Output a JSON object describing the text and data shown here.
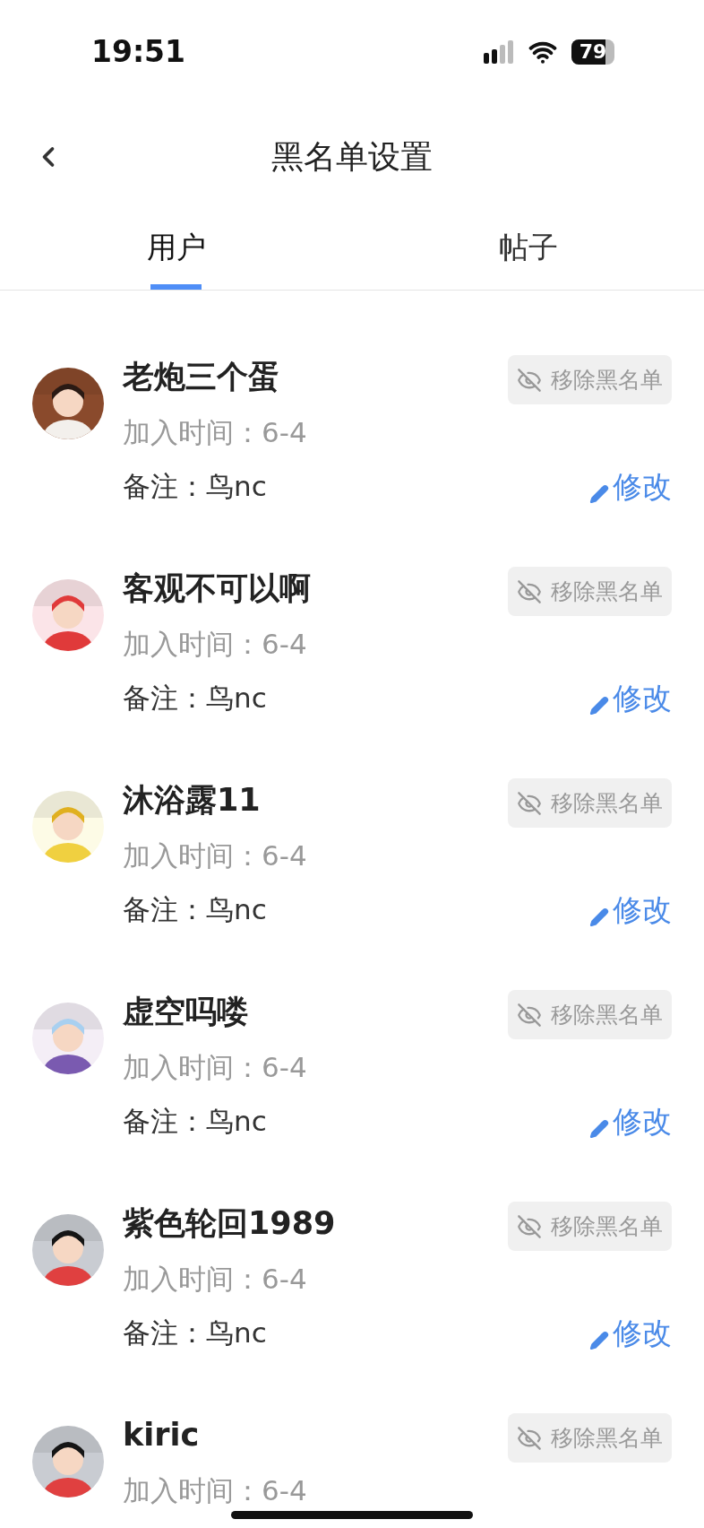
{
  "status_bar": {
    "time": "19:51",
    "battery": "79"
  },
  "header": {
    "title": "黑名单设置"
  },
  "tabs": [
    {
      "label": "用户",
      "selected": true
    },
    {
      "label": "帖子",
      "selected": false
    }
  ],
  "users": [
    {
      "name": "老炮三个蛋",
      "joined": "加入时间：6-4",
      "note": "备注：鸟nc",
      "remove_label": "移除黑名单",
      "edit_label": "修改"
    },
    {
      "name": "客观不可以啊",
      "joined": "加入时间：6-4",
      "note": "备注：鸟nc",
      "remove_label": "移除黑名单",
      "edit_label": "修改"
    },
    {
      "name": "沐浴露11",
      "joined": "加入时间：6-4",
      "note": "备注：鸟nc",
      "remove_label": "移除黑名单",
      "edit_label": "修改"
    },
    {
      "name": "虚空吗喽",
      "joined": "加入时间：6-4",
      "note": "备注：鸟nc",
      "remove_label": "移除黑名单",
      "edit_label": "修改"
    },
    {
      "name": "紫色轮回1989",
      "joined": "加入时间：6-4",
      "note": "备注：鸟nc",
      "remove_label": "移除黑名单",
      "edit_label": "修改"
    },
    {
      "name": "kiric",
      "joined": "加入时间：6-4",
      "remove_label": "移除黑名单"
    }
  ]
}
